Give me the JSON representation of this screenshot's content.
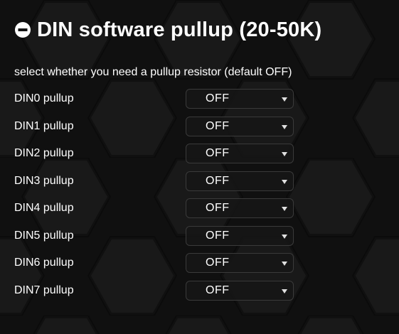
{
  "section": {
    "title": "DIN software pullup (20-50K)",
    "description": "select whether you need a pullup resistor (default OFF)",
    "collapse_icon": "minus-circle-icon"
  },
  "rows": [
    {
      "label": "DIN0 pullup",
      "value": "OFF"
    },
    {
      "label": "DIN1 pullup",
      "value": "OFF"
    },
    {
      "label": "DIN2 pullup",
      "value": "OFF"
    },
    {
      "label": "DIN3 pullup",
      "value": "OFF"
    },
    {
      "label": "DIN4 pullup",
      "value": "OFF"
    },
    {
      "label": "DIN5 pullup",
      "value": "OFF"
    },
    {
      "label": "DIN6 pullup",
      "value": "OFF"
    },
    {
      "label": "DIN7 pullup",
      "value": "OFF"
    }
  ],
  "colors": {
    "background": "#121212",
    "text": "#ffffff",
    "select_border": "#3a3a3a"
  }
}
